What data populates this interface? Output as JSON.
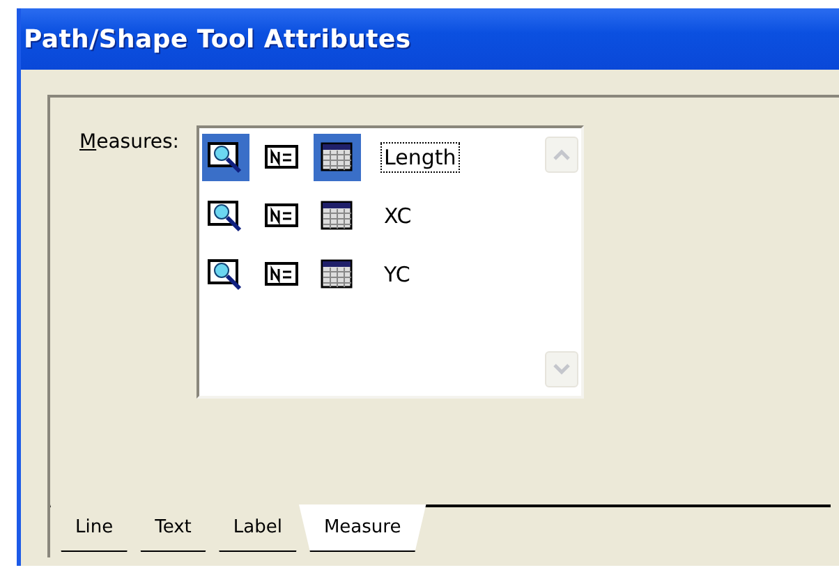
{
  "window": {
    "title": "Path/Shape Tool Attributes"
  },
  "measures": {
    "label": "Measures:",
    "mnemonic_underlined": true,
    "rows": [
      {
        "label": "Length",
        "focused": true,
        "icons": [
          {
            "kind": "magnifier",
            "selected": true
          },
          {
            "kind": "text",
            "selected": false
          },
          {
            "kind": "table",
            "selected": true
          }
        ]
      },
      {
        "label": "XC",
        "focused": false,
        "icons": [
          {
            "kind": "magnifier",
            "selected": false
          },
          {
            "kind": "text",
            "selected": false
          },
          {
            "kind": "table",
            "selected": false
          }
        ]
      },
      {
        "label": "YC",
        "focused": false,
        "icons": [
          {
            "kind": "magnifier",
            "selected": false
          },
          {
            "kind": "text",
            "selected": false
          },
          {
            "kind": "table",
            "selected": false
          }
        ]
      }
    ]
  },
  "tabs": [
    {
      "label": "Line",
      "selected": false
    },
    {
      "label": "Text",
      "selected": false
    },
    {
      "label": "Label",
      "selected": false
    },
    {
      "label": "Measure",
      "selected": true
    }
  ]
}
